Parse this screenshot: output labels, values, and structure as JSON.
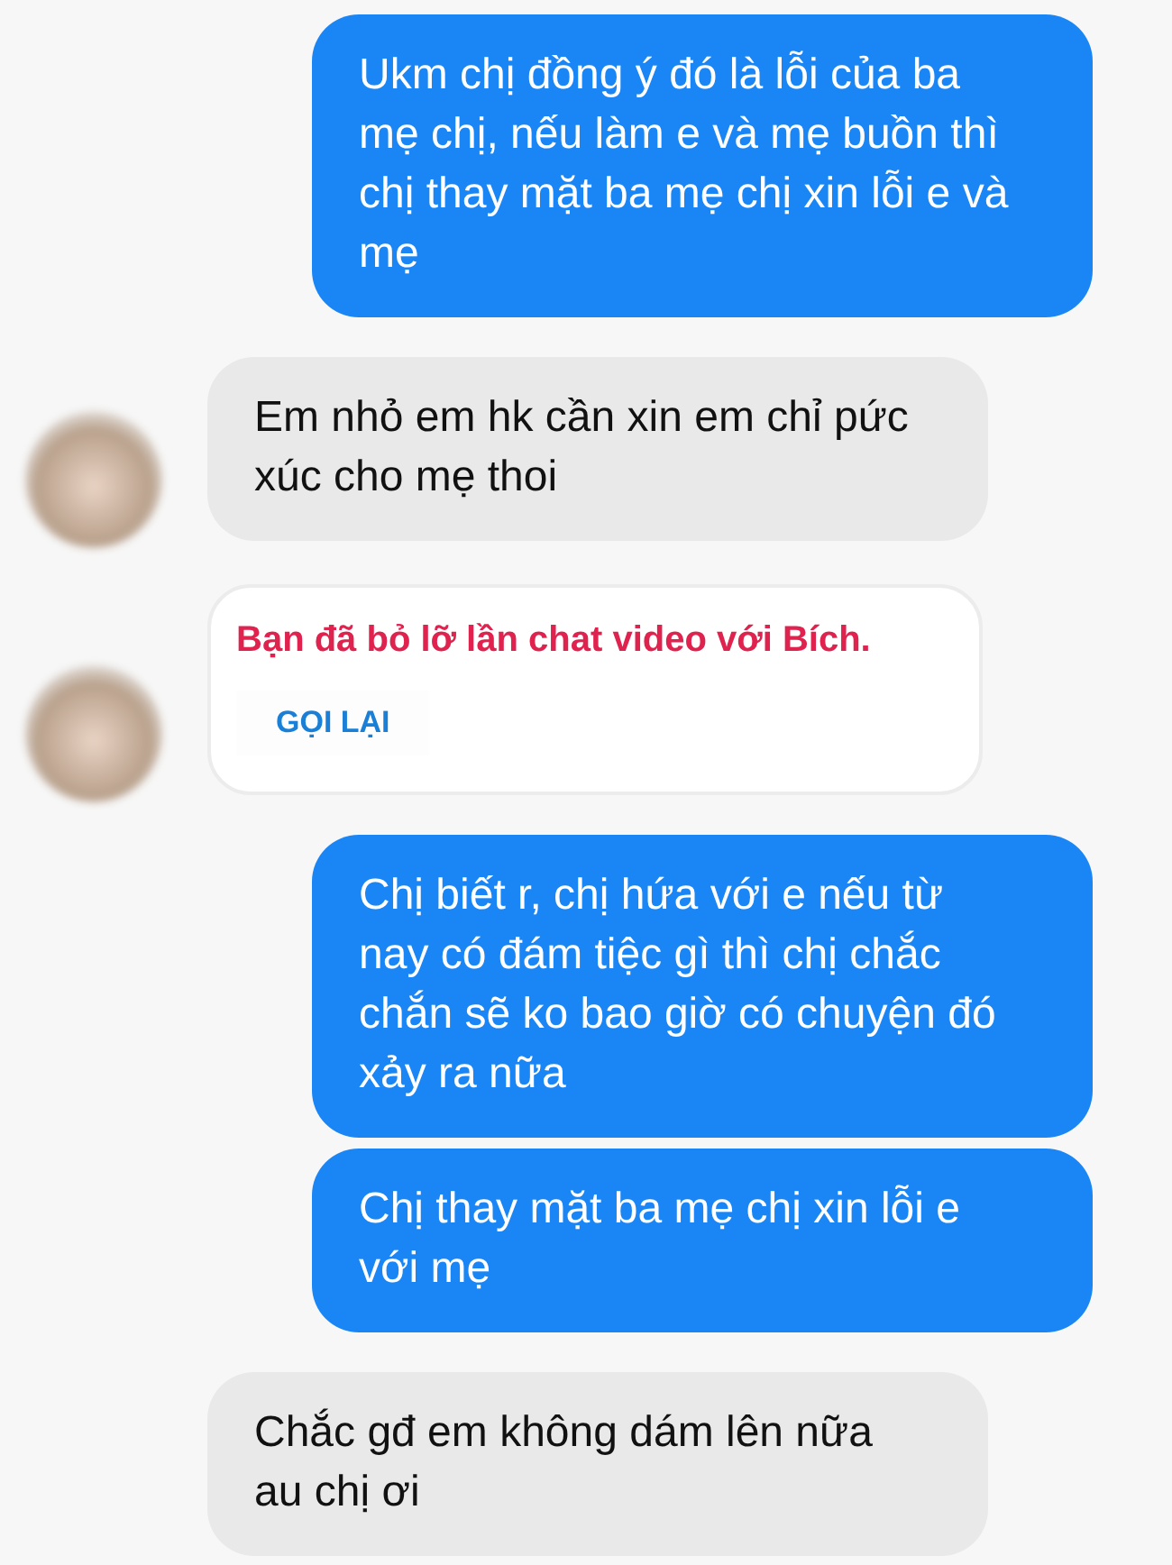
{
  "messages": [
    {
      "kind": "outgoing",
      "text": "Ukm chị đồng ý đó là lỗi của ba mẹ chị, nếu làm e và mẹ buồn thì chị thay mặt ba mẹ chị xin lỗi e và mẹ"
    },
    {
      "kind": "incoming",
      "avatar": true,
      "text": "Em nhỏ em hk cần xin em chỉ pức xúc cho mẹ thoi"
    },
    {
      "kind": "missed_call",
      "avatar": true,
      "text": "Bạn đã bỏ lỡ lần chat video với Bích.",
      "action": "GỌI LẠI"
    },
    {
      "kind": "outgoing",
      "text": "Chị biết r, chị hứa với e nếu từ nay có đám tiệc gì thì chị chắc chắn sẽ ko bao giờ có chuyện đó xảy ra nữa"
    },
    {
      "kind": "outgoing",
      "text": "Chị thay mặt ba mẹ chị xin lỗi e với mẹ"
    },
    {
      "kind": "incoming",
      "avatar": false,
      "text": "Chắc gđ em không dám lên nữa au chị ơi"
    }
  ]
}
